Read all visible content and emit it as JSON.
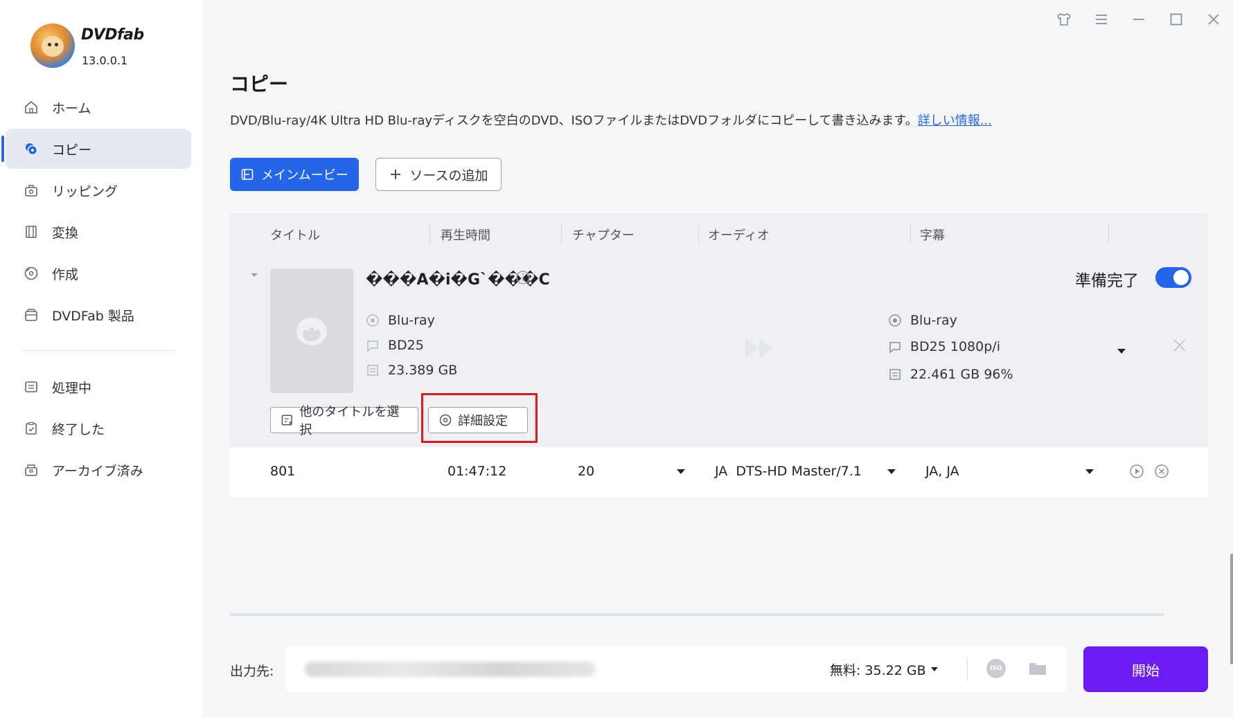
{
  "app": {
    "brand": "DVDfab",
    "version": "13.0.0.1"
  },
  "sidebar": {
    "items": [
      {
        "label": "ホーム",
        "icon": "home-icon"
      },
      {
        "label": "コピー",
        "icon": "copy-icon",
        "active": true
      },
      {
        "label": "リッピング",
        "icon": "ripper-icon"
      },
      {
        "label": "変換",
        "icon": "film-icon"
      },
      {
        "label": "作成",
        "icon": "disc-create-icon"
      },
      {
        "label": "DVDFab 製品",
        "icon": "box-icon"
      },
      {
        "label": "処理中",
        "icon": "list-icon"
      },
      {
        "label": "終了した",
        "icon": "check-clipboard-icon"
      },
      {
        "label": "アーカイブ済み",
        "icon": "archive-icon"
      }
    ]
  },
  "main": {
    "title": "コピー",
    "description": "DVD/Blu-ray/4K Ultra HD Blu-rayディスクを空白のDVD、ISOファイルまたはDVDフォルダにコピーして書き込みます。",
    "more_link": "詳しい情報...",
    "main_movie_button": "メインムービー",
    "add_source_button": "ソースの追加"
  },
  "table": {
    "columns": [
      "タイトル",
      "再生時間",
      "チャプター",
      "オーディオ",
      "字幕"
    ],
    "disc": {
      "title": "���A�i�G`���C",
      "source": {
        "type": "Blu-ray",
        "format": "BD25",
        "size": "23.389 GB"
      },
      "target": {
        "type": "Blu-ray",
        "format": "BD25 1080p/i",
        "size": "22.461 GB 96%"
      },
      "ready_label": "準備完了",
      "ready": true,
      "select_title_button": "他のタイトルを選択",
      "advanced_button": "詳細設定"
    },
    "row": {
      "title": "801",
      "duration": "01:47:12",
      "chapters": "20",
      "audio": "JA  DTS-HD Master/7.1",
      "subtitles": "JA, JA"
    }
  },
  "footer": {
    "output_label": "出力先:",
    "free_space": "無料:  35.22 GB",
    "iso_label": "ISO",
    "start_button": "開始"
  },
  "colors": {
    "accent": "#2566e8",
    "start": "#6e1cf4",
    "highlight": "#e0191f"
  }
}
